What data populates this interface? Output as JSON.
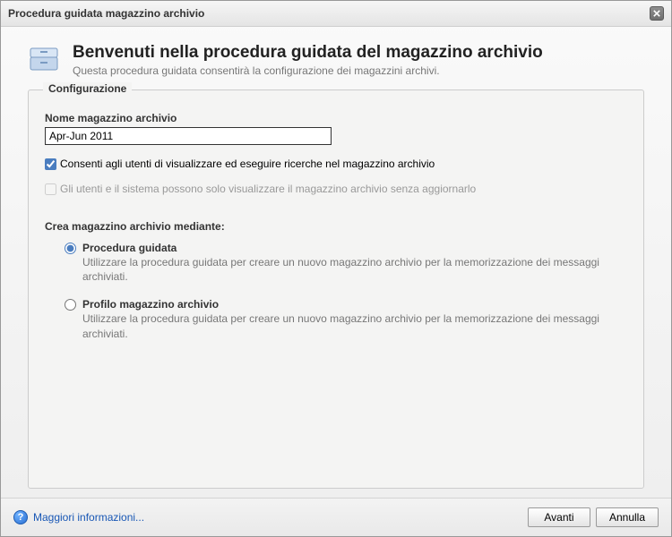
{
  "window": {
    "title": "Procedura guidata magazzino archivio"
  },
  "header": {
    "heading": "Benvenuti nella procedura guidata del magazzino archivio",
    "subheading": "Questa procedura guidata consentirà la configurazione dei magazzini archivi."
  },
  "config": {
    "legend": "Configurazione",
    "store_name_label": "Nome magazzino archivio",
    "store_name_value": "Apr-Jun 2011",
    "allow_search_label": "Consenti agli utenti di visualizzare ed eseguire ricerche nel magazzino archivio",
    "allow_search_checked": true,
    "readonly_label": "Gli utenti e il sistema possono solo visualizzare il magazzino archivio senza aggiornarlo",
    "readonly_checked": false,
    "readonly_disabled": true,
    "create_using_label": "Crea magazzino archivio mediante:",
    "radios": {
      "wizard": {
        "label": "Procedura guidata",
        "desc": "Utilizzare la procedura guidata per creare un nuovo magazzino archivio per la memorizzazione dei messaggi archiviati."
      },
      "profile": {
        "label": "Profilo magazzino archivio",
        "desc": "Utilizzare la procedura guidata per creare un nuovo magazzino archivio per la memorizzazione dei messaggi archiviati."
      },
      "selected": "wizard"
    }
  },
  "footer": {
    "help_link": "Maggiori informazioni...",
    "next": "Avanti",
    "cancel": "Annulla"
  }
}
